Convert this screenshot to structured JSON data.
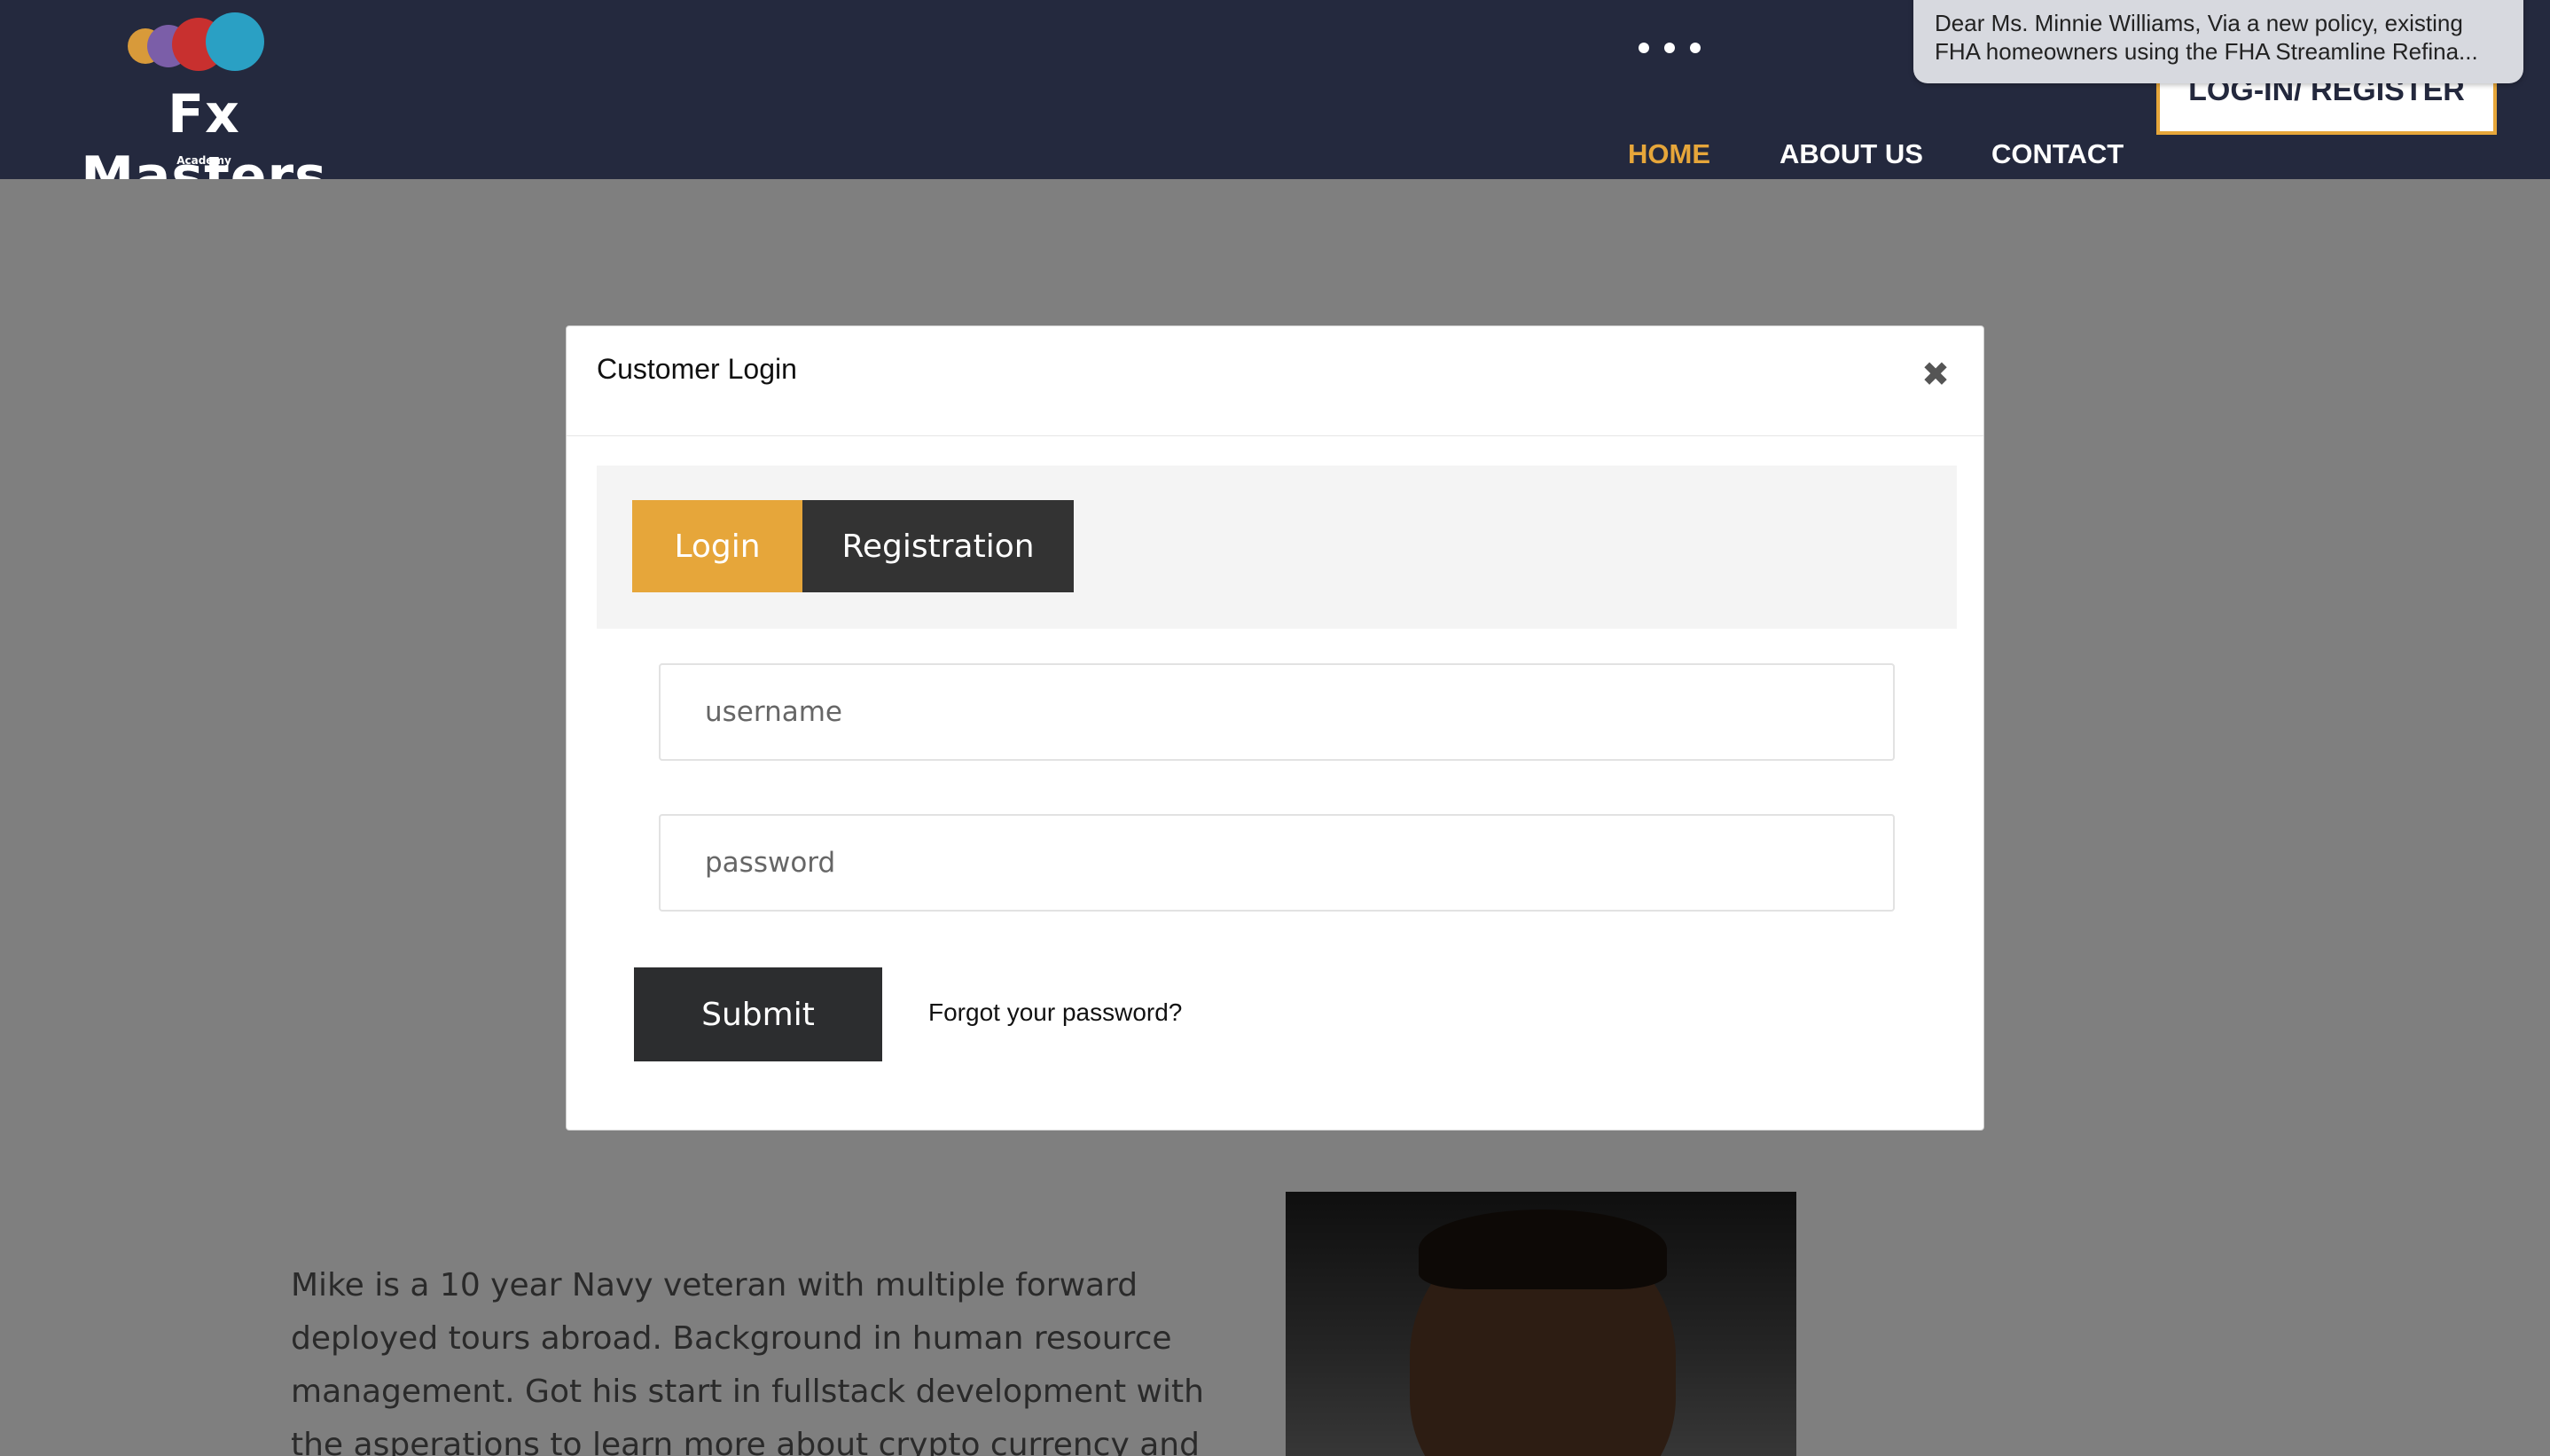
{
  "brand": {
    "name": "Fx Masters",
    "subtitle": "Academy",
    "colors": {
      "dot1": "#d89a3a",
      "dot2": "#7b5ea8",
      "dot3": "#c8302f",
      "dot4": "#2aa0c4"
    }
  },
  "nav": {
    "items": [
      {
        "label": "HOME",
        "active": true
      },
      {
        "label": "ABOUT US",
        "active": false
      },
      {
        "label": "CONTACT",
        "active": false
      }
    ],
    "register_label": "LOG-IN/ REGISTER",
    "accent_color": "#e6a63a",
    "background_color": "#24293e"
  },
  "notification": {
    "line1": "Dear Ms. Minnie Williams, Via a new policy, existing",
    "line2": "FHA homeowners using the FHA Streamline Refina..."
  },
  "modal": {
    "title": "Customer Login",
    "close_icon": "close-icon",
    "tabs": [
      {
        "label": "Login",
        "active": true
      },
      {
        "label": "Registration",
        "active": false
      }
    ],
    "username": {
      "value": "",
      "placeholder": "username"
    },
    "password": {
      "value": "",
      "placeholder": "password"
    },
    "submit_label": "Submit",
    "forgot_label": "Forgot your password?"
  },
  "bio": {
    "text": "Mike is a 10 year Navy veteran with multiple forward deployed tours abroad. Background in human resource management. Got his start in fullstack development with the asperations to learn more about crypto currency and Blockchain mechanics and"
  }
}
